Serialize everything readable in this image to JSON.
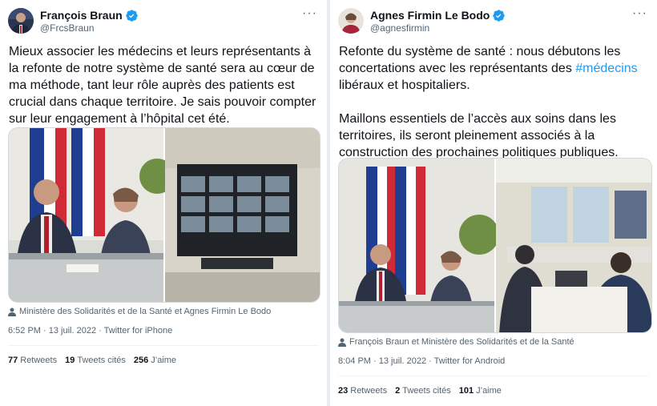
{
  "tweets": [
    {
      "author_name": "François Braun",
      "handle": "@FrcsBraun",
      "more_label": "···",
      "text": "Mieux associer les médecins et leurs représentants à la refonte de notre système de santé sera au cœur de ma méthode, tant leur rôle auprès des patients est crucial dans chaque territoire. Je sais pouvoir compter sur leur engagement à l’hôpital cet été.",
      "tagged": "Ministère des Solidarités et de la Santé et Agnes Firmin Le Bodo",
      "meta": "6:52 PM · 13 juil. 2022 · Twitter for iPhone",
      "stats": {
        "retweets_count": "77",
        "retweets_label": "Retweets",
        "quotes_count": "19",
        "quotes_label": "Tweets cités",
        "likes_count": "256",
        "likes_label": "J’aime"
      }
    },
    {
      "author_name": "Agnes Firmin Le Bodo",
      "handle": "@agnesfirmin",
      "more_label": "···",
      "text_before": "Refonte du système de santé : nous débutons les concertations avec les représentants des ",
      "hashtag": "#médecins",
      "text_after": " libéraux et hospitaliers.\n\nMaillons essentiels de l’accès aux soins dans les territoires, ils seront pleinement associés à la construction des prochaines politiques publiques.",
      "tagged": "François Braun et Ministère des Solidarités et de la Santé",
      "meta": "8:04 PM · 13 juil. 2022 · Twitter for Android",
      "stats": {
        "retweets_count": "23",
        "retweets_label": "Retweets",
        "quotes_count": "2",
        "quotes_label": "Tweets cités",
        "likes_count": "101",
        "likes_label": "J’aime"
      }
    }
  ],
  "colors": {
    "verified": "#1d9bf0",
    "link": "#1d9bf0",
    "secondary_text": "#536471",
    "border": "#cfd9de"
  },
  "icons": {
    "verified": "verified-badge-icon",
    "more": "more-options-icon",
    "tag": "person-tag-icon"
  }
}
